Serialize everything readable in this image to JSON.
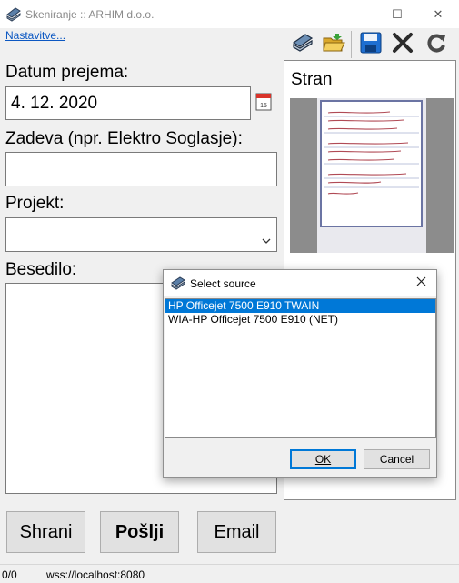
{
  "window": {
    "title": "Skeniranje :: ARHIM d.o.o.",
    "minimize_glyph": "—",
    "maximize_glyph": "☐",
    "close_glyph": "✕"
  },
  "settings_link": "Nastavitve...",
  "toolbar": {
    "buttons": [
      {
        "name": "scanner-icon"
      },
      {
        "name": "open-folder-icon"
      },
      {
        "name": "save-icon"
      },
      {
        "name": "delete-icon"
      },
      {
        "name": "refresh-icon"
      }
    ]
  },
  "form": {
    "date_label": "Datum prejema:",
    "date_value": "4. 12. 2020",
    "calendar_day": "15",
    "subject_label": "Zadeva (npr. Elektro Soglasje):",
    "subject_value": "",
    "project_label": "Projekt:",
    "project_value": "",
    "text_label": "Besedilo:",
    "text_value": ""
  },
  "page_panel": {
    "title": "Stran"
  },
  "actions": {
    "save": "Shrani",
    "send": "Pošlji",
    "email": "Email"
  },
  "status": {
    "counter": "0/0",
    "connection": "wss://localhost:8080"
  },
  "dialog": {
    "title": "Select source",
    "sources": [
      {
        "label": "HP Officejet 7500 E910 TWAIN",
        "selected": true
      },
      {
        "label": "WIA-HP Officejet 7500 E910 (NET)",
        "selected": false
      }
    ],
    "ok": "OK",
    "cancel": "Cancel"
  },
  "colors": {
    "accent": "#0078d7",
    "link": "#0b57c2",
    "window_bg": "#f0f0f0"
  }
}
